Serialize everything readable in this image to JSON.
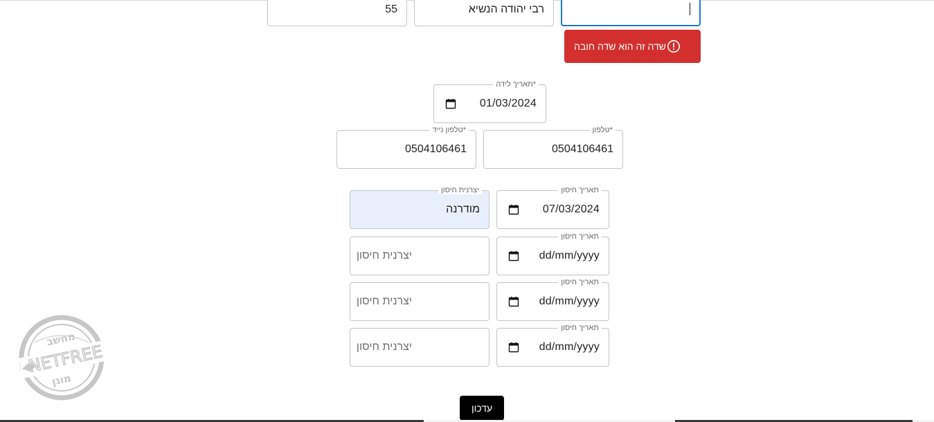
{
  "address": {
    "house_number": {
      "value": "55"
    },
    "street": {
      "value": "רבי יהודה הנשיא"
    },
    "focused_field": {
      "value": ""
    }
  },
  "error": {
    "message": "שדה זה הוא שדה חובה",
    "icon": "error-circle-icon",
    "color": "#d32f2f"
  },
  "birth_date": {
    "label": "*תאריך לידה",
    "value": "01/03/2024"
  },
  "phones": {
    "phone": {
      "label": "*טלפון",
      "value": "0504106461"
    },
    "mobile": {
      "label": "*טלפון נייד",
      "value": "0504106461"
    }
  },
  "vaccinations": [
    {
      "date_label": "תאריך חיסון",
      "date_value": "07/03/2024",
      "maker_label": "יצרנית חיסון",
      "maker_value": "מודרנה",
      "maker_placeholder": ""
    },
    {
      "date_label": "תאריך חיסון",
      "date_value": "dd/mm/yyyy",
      "maker_label": "",
      "maker_value": "",
      "maker_placeholder": "יצרנית חיסון"
    },
    {
      "date_label": "תאריך חיסון",
      "date_value": "dd/mm/yyyy",
      "maker_label": "",
      "maker_value": "",
      "maker_placeholder": "יצרנית חיסון"
    },
    {
      "date_label": "תאריך חיסון",
      "date_value": "dd/mm/yyyy",
      "maker_label": "",
      "maker_value": "",
      "maker_placeholder": "יצרנית חיסון"
    }
  ],
  "actions": {
    "update_label": "עדכון"
  },
  "watermark": {
    "top_text": "מחשב",
    "brand": "NETFREE",
    "bottom_text": "מוגן"
  },
  "colors": {
    "focus": "#1976d2",
    "autofill_background": "#e8f0fe",
    "button": "#000000"
  }
}
